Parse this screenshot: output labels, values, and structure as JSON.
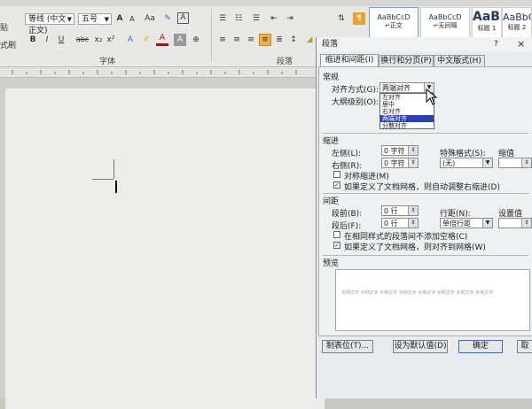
{
  "ribbon": {
    "side_labels": [
      "贴",
      "式刷",
      "式刷"
    ],
    "font_name": "等线 (中文正文)",
    "font_size": "五号",
    "font_group_label": "字体",
    "paragraph_group_label": "段落",
    "styles": [
      {
        "sample": "AaBbCcD",
        "name": "↵正文"
      },
      {
        "sample": "AaBbCcD",
        "name": "↵无间隔"
      },
      {
        "sample": "AaBl",
        "name": "标题 1"
      },
      {
        "sample": "AaBbC",
        "name": "标题 2"
      }
    ],
    "buttons": {
      "bold": "B",
      "italic": "I",
      "underline": "U",
      "strike": "abc",
      "subscript": "x₂",
      "superscript": "x²",
      "grow": "A",
      "shrink": "A",
      "change_case": "Aa",
      "clear": "A"
    }
  },
  "dialog": {
    "title": "段落",
    "help": "?",
    "close": "×",
    "tabs": [
      "缩进和间距(I)",
      "换行和分页(P)",
      "中文版式(H)"
    ],
    "general_header": "常规",
    "align_label": "对齐方式(G):",
    "align_value": "两端对齐",
    "align_options": [
      "左对齐",
      "居中",
      "右对齐",
      "两端对齐",
      "分散对齐"
    ],
    "outline_label": "大纲级别(O):",
    "indent_header": "缩进",
    "left_label": "左侧(L):",
    "left_value": "0 字符",
    "right_label": "右侧(R):",
    "right_value": "0 字符",
    "special_label": "特殊格式(S):",
    "special_value": "(无)",
    "indent_by_label": "缩值",
    "mirror_indent": "对称缩进(M)",
    "auto_adjust_indent": "如果定义了文档网格，则自动调整右缩进(D)",
    "spacing_header": "间距",
    "before_label": "段前(B):",
    "before_value": "0 行",
    "after_label": "段后(F):",
    "after_value": "0 行",
    "line_spacing_label": "行距(N):",
    "line_spacing_value": "单倍行距",
    "at_label": "设置值",
    "no_space_same_style": "在相同样式的段落间不添加空格(C)",
    "snap_to_grid": "如果定义了文档网格，则对齐到网格(W)",
    "preview_header": "预览",
    "preview_text": "示例文字 示例文字 示例文字 示例文字 示例文字 示例文字 示例文字 示例文字",
    "tabs_button": "制表位(T)...",
    "default_button": "设为默认值(D)",
    "ok_button": "确定",
    "cancel_button": "取"
  }
}
